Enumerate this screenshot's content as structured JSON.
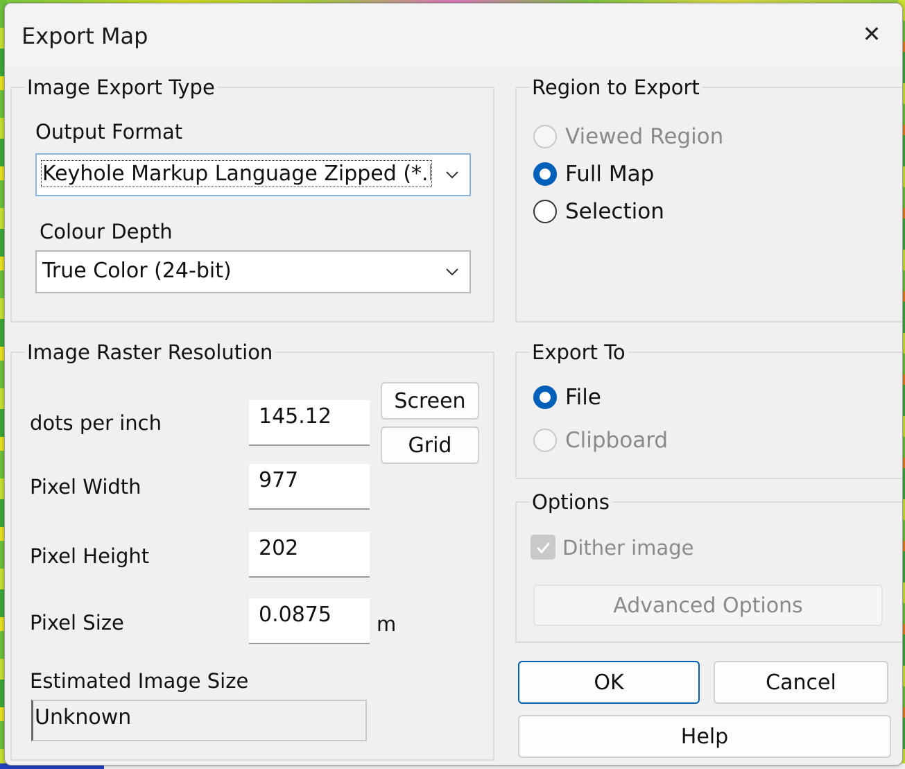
{
  "dialog": {
    "title": "Export Map",
    "close_symbol": "✕"
  },
  "image_export_type": {
    "group_label": "Image Export Type",
    "output_format_label": "Output Format",
    "output_format_value": "Keyhole Markup Language Zipped (*.kmz)",
    "colour_depth_label": "Colour Depth",
    "colour_depth_value": "True Color (24-bit)"
  },
  "region_to_export": {
    "group_label": "Region to Export",
    "options": [
      {
        "label": "Viewed Region",
        "checked": false,
        "disabled": true
      },
      {
        "label": "Full Map",
        "checked": true,
        "disabled": false
      },
      {
        "label": "Selection",
        "checked": false,
        "disabled": false
      }
    ]
  },
  "raster_resolution": {
    "group_label": "Image Raster Resolution",
    "dpi_label": "dots per inch",
    "dpi_value": "145.12",
    "screen_button": "Screen",
    "grid_button": "Grid",
    "pixel_width_label": "Pixel Width",
    "pixel_width_value": "977",
    "pixel_height_label": "Pixel Height",
    "pixel_height_value": "202",
    "pixel_size_label": "Pixel Size",
    "pixel_size_value": "0.0875",
    "pixel_size_unit": "m",
    "estimated_size_label": "Estimated Image Size",
    "estimated_size_value": "Unknown"
  },
  "export_to": {
    "group_label": "Export To",
    "options": [
      {
        "label": "File",
        "checked": true,
        "disabled": false
      },
      {
        "label": "Clipboard",
        "checked": false,
        "disabled": true
      }
    ]
  },
  "options": {
    "group_label": "Options",
    "dither_label": "Dither image",
    "dither_checked": true,
    "dither_disabled": true,
    "advanced_button": "Advanced Options"
  },
  "buttons": {
    "ok": "OK",
    "cancel": "Cancel",
    "help": "Help"
  },
  "colors": {
    "accent": "#005fb8",
    "dialog_bg": "#f0f0f0",
    "disabled_text": "#8a8a8a"
  }
}
